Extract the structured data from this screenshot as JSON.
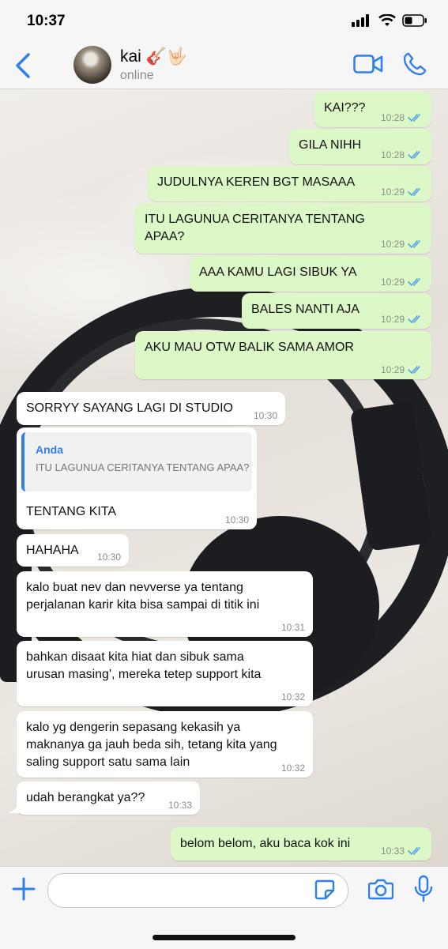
{
  "status_bar": {
    "time": "10:37"
  },
  "header": {
    "name": "kai 🎸🤟🏻",
    "status": "online"
  },
  "messages": [
    {
      "dir": "out",
      "text": "KAI???",
      "time": "10:28"
    },
    {
      "dir": "out",
      "text": "GILA NIHH",
      "time": "10:28"
    },
    {
      "dir": "out",
      "text": "JUDULNYA KEREN BGT MASAAA",
      "time": "10:29"
    },
    {
      "dir": "out",
      "text": "ITU LAGUNUA CERITANYA TENTANG\nAPAA?",
      "time": "10:29"
    },
    {
      "dir": "out",
      "text": "AAA KAMU LAGI SIBUK YA",
      "time": "10:29"
    },
    {
      "dir": "out",
      "text": "BALES NANTI AJA",
      "time": "10:29"
    },
    {
      "dir": "out",
      "text": "AKU MAU OTW BALIK SAMA AMOR",
      "time": "10:29"
    },
    {
      "dir": "in",
      "text": "SORRYY SAYANG LAGI DI STUDIO",
      "time": "10:30"
    },
    {
      "dir": "in",
      "text": "TENTANG KITA",
      "time": "10:30",
      "quote": {
        "author": "Anda",
        "text": "ITU LAGUNUA CERITANYA TENTANG APAA?"
      }
    },
    {
      "dir": "in",
      "text": "HAHAHA",
      "time": "10:30"
    },
    {
      "dir": "in",
      "text": "kalo buat nev dan nevverse ya tentang\nperjalanan karir kita bisa sampai di titik ini",
      "time": "10:31"
    },
    {
      "dir": "in",
      "text": "bahkan disaat kita hiat dan sibuk sama\nurusan masing', mereka tetep support kita",
      "time": "10:32"
    },
    {
      "dir": "in",
      "text": "kalo yg dengerin sepasang kekasih ya\nmaknanya ga jauh beda sih, tetang kita yang\nsaling support satu sama lain",
      "time": "10:32"
    },
    {
      "dir": "in",
      "text": "udah berangkat ya??",
      "time": "10:33"
    },
    {
      "dir": "out",
      "text": "belom belom, aku baca kok ini",
      "time": "10:33"
    }
  ],
  "input": {
    "placeholder": ""
  },
  "colors": {
    "accent": "#2f80ed",
    "outgoing": "#dcf8c6",
    "incoming": "#ffffff",
    "read_ticks": "#4fa3e6"
  },
  "icons": [
    "back-chevron-icon",
    "video-call-icon",
    "phone-icon",
    "plus-icon",
    "sticker-icon",
    "camera-icon",
    "microphone-icon",
    "double-check-icon"
  ]
}
